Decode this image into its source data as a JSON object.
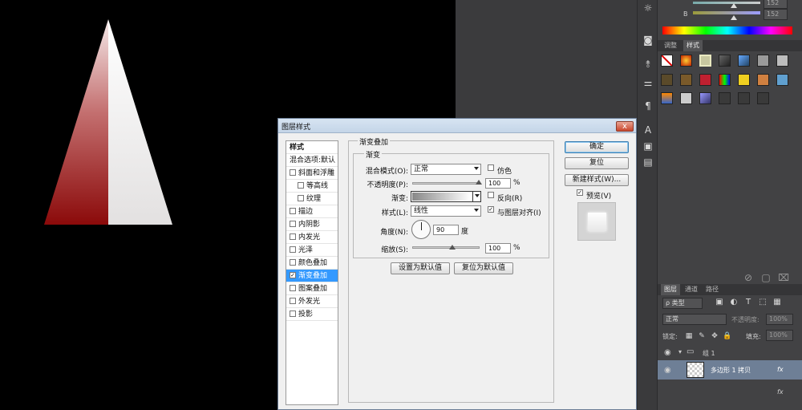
{
  "dialog": {
    "title": "图层样式",
    "close_glyph": "x",
    "styles_header": "样式",
    "blend_default": "混合选项:默认",
    "items": [
      {
        "label": "斜面和浮雕",
        "checked": false,
        "indent": false
      },
      {
        "label": "等高线",
        "checked": false,
        "indent": true
      },
      {
        "label": "纹理",
        "checked": false,
        "indent": true
      },
      {
        "label": "描边",
        "checked": false,
        "indent": false
      },
      {
        "label": "内阴影",
        "checked": false,
        "indent": false
      },
      {
        "label": "内发光",
        "checked": false,
        "indent": false
      },
      {
        "label": "光泽",
        "checked": false,
        "indent": false
      },
      {
        "label": "颜色叠加",
        "checked": false,
        "indent": false
      },
      {
        "label": "渐变叠加",
        "checked": true,
        "indent": false,
        "selected": true
      },
      {
        "label": "图案叠加",
        "checked": false,
        "indent": false
      },
      {
        "label": "外发光",
        "checked": false,
        "indent": false
      },
      {
        "label": "投影",
        "checked": false,
        "indent": false
      }
    ],
    "section_title": "渐变叠加",
    "subsection_title": "渐变",
    "blend_mode_label": "混合模式(O):",
    "blend_mode_value": "正常",
    "dither_label": "仿色",
    "opacity_label": "不透明度(P):",
    "opacity_value": "100",
    "percent": "%",
    "gradient_label": "渐变:",
    "reverse_label": "反向(R)",
    "style_label": "样式(L):",
    "style_value": "线性",
    "align_label": "与图层对齐(I)",
    "align_checked": true,
    "angle_label": "角度(N):",
    "angle_value": "90",
    "degree": "度",
    "scale_label": "缩放(S):",
    "scale_value": "100",
    "set_default": "设置为默认值",
    "reset_default": "复位为默认值",
    "ok": "确定",
    "reset": "复位",
    "new_style": "新建样式(W)...",
    "preview_label": "预览(V)",
    "preview_checked": true,
    "check_glyph": "✓"
  },
  "panels": {
    "color_b_label": "B",
    "color_values": [
      "152",
      "152"
    ],
    "tab_adjust": "调整",
    "tab_styles": "样式",
    "tab_layers": "图层",
    "tab_channels": "通道",
    "tab_paths": "路径",
    "filter_kind": "ρ 类型",
    "blend_mode": "正常",
    "opacity_label": "不透明度:",
    "opacity_value": "100%",
    "lock_label": "锁定:",
    "fill_label": "填充:",
    "fill_value": "100%",
    "group_name": "组 1",
    "layer_name": "多边形 1 拷贝",
    "fx": "fx"
  },
  "colors": {
    "triangle_dark": "#8b0a0a",
    "triangle_light": "#e6e4e4",
    "selection_blue": "#3399ff",
    "panel_bg": "#424244"
  }
}
